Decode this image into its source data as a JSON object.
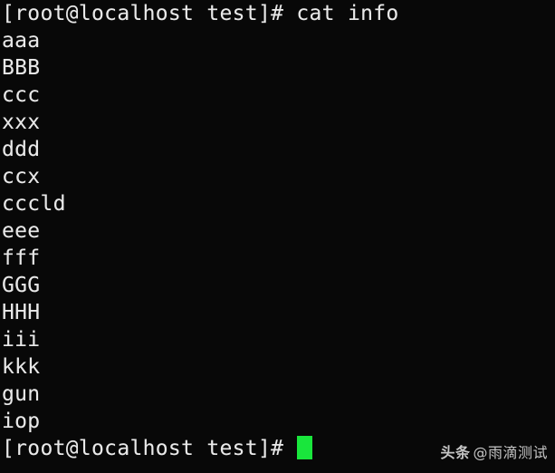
{
  "terminal": {
    "background_color": "#080808",
    "foreground_color": "#e8e8e8",
    "cursor_color": "#19e63c",
    "command_line": "[root@localhost test]# cat info",
    "prompt": "[root@localhost test]# ",
    "command": "cat info",
    "output_lines": [
      "aaa",
      "BBB",
      "ccc",
      "xxx",
      "ddd",
      "ccx",
      "cccld",
      "eee",
      "fff",
      "GGG",
      "HHH",
      "iii",
      "kkk",
      "gun",
      "iop"
    ],
    "final_prompt": "[root@localhost test]# ",
    "cursor": "block-cursor"
  },
  "watermark": {
    "brand": "头条",
    "handle": "@雨滴测试",
    "color": "#d6d6d6"
  }
}
